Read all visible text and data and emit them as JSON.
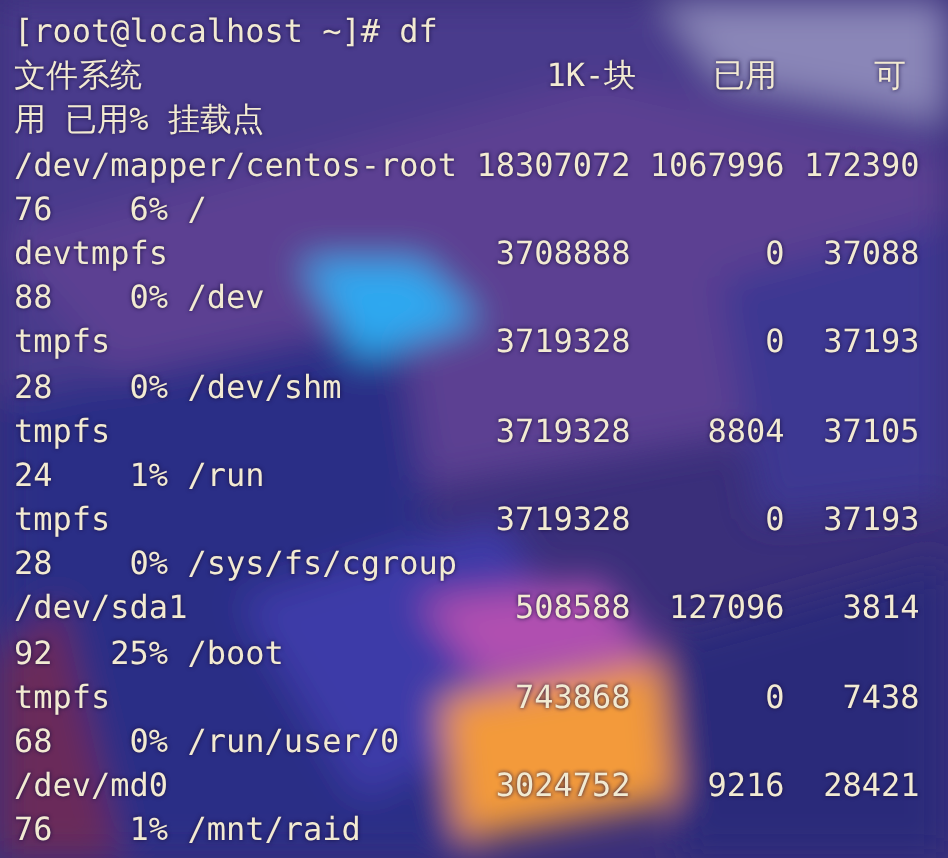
{
  "terminal": {
    "lines": [
      "[root@localhost ~]# df",
      "文件系统                     1K-块    已用     可",
      "用 已用% 挂载点",
      "/dev/mapper/centos-root 18307072 1067996 172390",
      "76    6% /",
      "devtmpfs                 3708888       0  37088",
      "88    0% /dev",
      "tmpfs                    3719328       0  37193",
      "28    0% /dev/shm",
      "tmpfs                    3719328    8804  37105",
      "24    1% /run",
      "tmpfs                    3719328       0  37193",
      "28    0% /sys/fs/cgroup",
      "/dev/sda1                 508588  127096   3814",
      "92   25% /boot",
      "tmpfs                     743868       0   7438",
      "68    0% /run/user/0",
      "/dev/md0                 3024752    9216  28421",
      "76    1% /mnt/raid"
    ]
  }
}
